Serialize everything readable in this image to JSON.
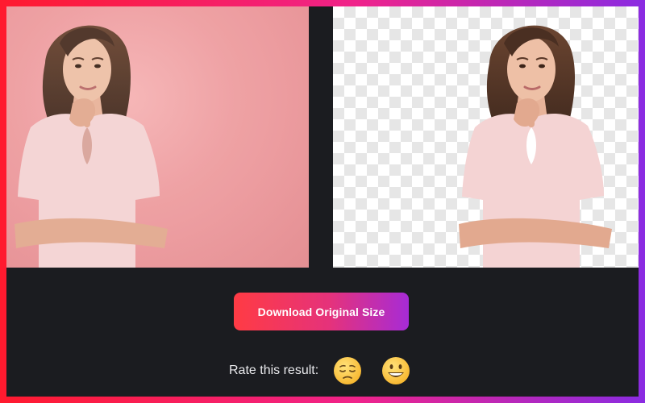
{
  "actions": {
    "download_label": "Download Original Size"
  },
  "rating": {
    "label": "Rate this result:",
    "options": [
      {
        "name": "sad",
        "icon": "pensive-face-icon"
      },
      {
        "name": "happy",
        "icon": "grinning-face-icon"
      }
    ]
  },
  "colors": {
    "frame_gradient": [
      "#ff1a2e",
      "#f0238a",
      "#8a2be2"
    ],
    "background": "#1b1c20",
    "button_gradient": [
      "#ff3b44",
      "#e5327b",
      "#a72bd6"
    ],
    "original_photo_background": "#ee9c9f"
  }
}
